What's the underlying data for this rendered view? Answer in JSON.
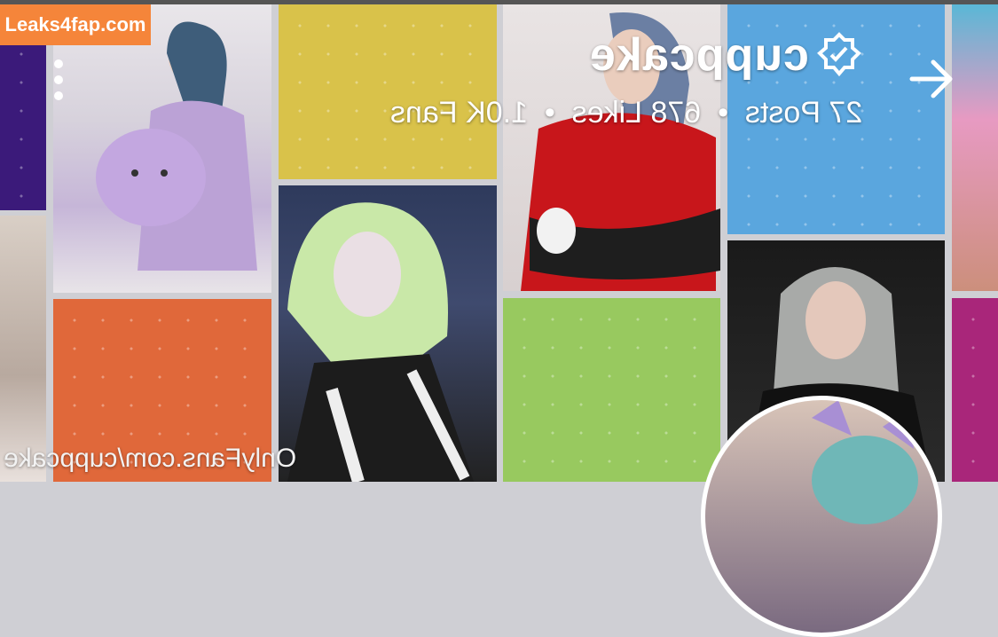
{
  "watermark": {
    "label": "Leaks4fap.com"
  },
  "profile": {
    "username": "cuppcake",
    "stats": "27 Posts  •  678 Likes  •  1.0K Fans",
    "url": "OnlyFans.com/cuppcake"
  },
  "icons": {
    "menu": "more-vertical-icon",
    "next": "arrow-right-icon",
    "verified": "verified-badge-icon"
  },
  "colors": {
    "watermark_bg": "#f5853a",
    "purple": "#3b1a7a",
    "yellow": "#d9c24a",
    "blue": "#5aa6de",
    "orange": "#e0683a",
    "green": "#98c95f",
    "magenta": "#a9267a"
  },
  "photos": {
    "p1": "photo of person with purple plush toy",
    "p2": "photo of person with green hair",
    "p3": "photo of person in red top",
    "p4": "photo of person with silver hair",
    "p5": "partial photo at left edge",
    "p6": "partial photo at right edge",
    "avatar": "profile avatar photo"
  }
}
